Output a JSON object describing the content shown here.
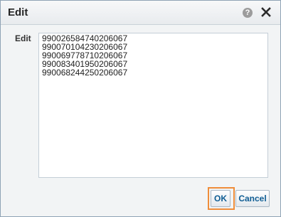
{
  "dialog": {
    "title": "Edit",
    "help_icon": "question-circle-icon",
    "help_glyph": "?",
    "close_icon": "close-x-icon"
  },
  "form": {
    "label": "Edit",
    "value": "990026584740206067\n990070104230206067\n990069778710206067\n990083401950206067\n990068244250206067"
  },
  "buttons": {
    "ok_label": "OK",
    "cancel_label": "Cancel"
  },
  "colors": {
    "highlight": "#ef8d3a",
    "button_text": "#0f5d94"
  }
}
